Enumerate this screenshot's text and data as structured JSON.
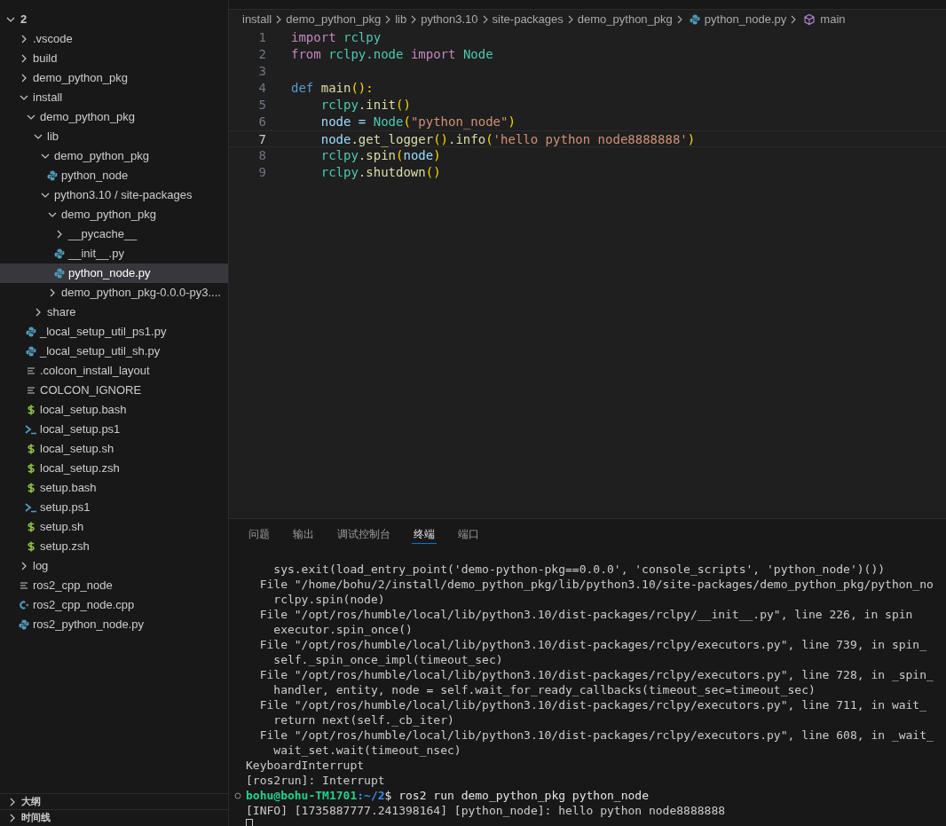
{
  "explorer": {
    "tree": {
      "label": "2",
      "kind": "folder",
      "expanded": true,
      "children": [
        {
          "label": ".vscode",
          "kind": "folder",
          "expanded": false
        },
        {
          "label": "build",
          "kind": "folder",
          "expanded": false
        },
        {
          "label": "demo_python_pkg",
          "kind": "folder",
          "expanded": false
        },
        {
          "label": "install",
          "kind": "folder",
          "expanded": true,
          "children": [
            {
              "label": "demo_python_pkg",
              "kind": "folder",
              "expanded": true,
              "children": [
                {
                  "label": "lib",
                  "kind": "folder",
                  "expanded": true,
                  "children": [
                    {
                      "label": "demo_python_pkg",
                      "kind": "folder",
                      "expanded": true,
                      "children": [
                        {
                          "label": "python_node",
                          "kind": "python",
                          "selected": false
                        }
                      ]
                    },
                    {
                      "label": "python3.10 / site-packages",
                      "kind": "folder",
                      "expanded": true,
                      "children": [
                        {
                          "label": "demo_python_pkg",
                          "kind": "folder",
                          "expanded": true,
                          "children": [
                            {
                              "label": "__pycache__",
                              "kind": "folder",
                              "expanded": false
                            },
                            {
                              "label": "__init__.py",
                              "kind": "python",
                              "selected": false
                            },
                            {
                              "label": "python_node.py",
                              "kind": "python",
                              "selected": true
                            }
                          ]
                        },
                        {
                          "label": "demo_python_pkg-0.0.0-py3....",
                          "kind": "folder",
                          "expanded": false
                        }
                      ]
                    }
                  ]
                },
                {
                  "label": "share",
                  "kind": "folder",
                  "expanded": false
                }
              ]
            },
            {
              "label": "_local_setup_util_ps1.py",
              "kind": "python",
              "selected": false
            },
            {
              "label": "_local_setup_util_sh.py",
              "kind": "python",
              "selected": false
            },
            {
              "label": ".colcon_install_layout",
              "kind": "text",
              "selected": false
            },
            {
              "label": "COLCON_IGNORE",
              "kind": "text",
              "selected": false
            },
            {
              "label": "local_setup.bash",
              "kind": "shell",
              "selected": false
            },
            {
              "label": "local_setup.ps1",
              "kind": "powershell",
              "selected": false
            },
            {
              "label": "local_setup.sh",
              "kind": "shell",
              "selected": false
            },
            {
              "label": "local_setup.zsh",
              "kind": "shell",
              "selected": false
            },
            {
              "label": "setup.bash",
              "kind": "shell",
              "selected": false
            },
            {
              "label": "setup.ps1",
              "kind": "powershell",
              "selected": false
            },
            {
              "label": "setup.sh",
              "kind": "shell",
              "selected": false
            },
            {
              "label": "setup.zsh",
              "kind": "shell",
              "selected": false
            }
          ]
        },
        {
          "label": "log",
          "kind": "folder",
          "expanded": false
        },
        {
          "label": "ros2_cpp_node",
          "kind": "text",
          "selected": false
        },
        {
          "label": "ros2_cpp_node.cpp",
          "kind": "cpp",
          "selected": false
        },
        {
          "label": "ros2_python_node.py",
          "kind": "python",
          "selected": false
        }
      ]
    },
    "sections": [
      {
        "label": "大纲",
        "expanded": false
      },
      {
        "label": "时间线",
        "expanded": false
      }
    ]
  },
  "breadcrumbs": [
    {
      "label": "install",
      "kind": "folder"
    },
    {
      "label": "demo_python_pkg",
      "kind": "folder"
    },
    {
      "label": "lib",
      "kind": "folder"
    },
    {
      "label": "python3.10",
      "kind": "folder"
    },
    {
      "label": "site-packages",
      "kind": "folder"
    },
    {
      "label": "demo_python_pkg",
      "kind": "folder"
    },
    {
      "label": "python_node.py",
      "kind": "python"
    },
    {
      "label": "main",
      "kind": "method"
    }
  ],
  "editor": {
    "lines": [
      {
        "number": "1",
        "current": false,
        "tokens": [
          {
            "text": "import ",
            "color": "#c586c0"
          },
          {
            "text": "rclpy",
            "color": "#4ec9b0"
          }
        ]
      },
      {
        "number": "2",
        "current": false,
        "tokens": [
          {
            "text": "from ",
            "color": "#c586c0"
          },
          {
            "text": "rclpy.node ",
            "color": "#4ec9b0"
          },
          {
            "text": "import ",
            "color": "#c586c0"
          },
          {
            "text": "Node",
            "color": "#4ec9b0"
          }
        ]
      },
      {
        "number": "3",
        "current": false
      },
      {
        "number": "4",
        "current": false,
        "tokens": [
          {
            "text": "def ",
            "color": "#569cd6"
          },
          {
            "text": "main",
            "color": "#dcdcaa"
          },
          {
            "text": "():",
            "color": "#ffd700"
          }
        ]
      },
      {
        "number": "5",
        "current": false,
        "tokens": [
          {
            "text": "    rclpy",
            "color": "#4ec9b0"
          },
          {
            "text": ".init",
            "color": "#dcdcaa"
          },
          {
            "text": "()",
            "color": "#ffd700"
          }
        ]
      },
      {
        "number": "6",
        "current": false,
        "tokens": [
          {
            "text": "    node =",
            "color": "#9cdcfe"
          },
          {
            "text": " Node",
            "color": "#4ec9b0"
          },
          {
            "text": "(",
            "color": "#ffd700"
          },
          {
            "text": "\"python_node\"",
            "color": "#ce9178"
          },
          {
            "text": ")",
            "color": "#ffd700"
          }
        ]
      },
      {
        "number": "7",
        "current": true,
        "tokens": [
          {
            "text": "    node",
            "color": "#9cdcfe"
          },
          {
            "text": ".get_logger",
            "color": "#dcdcaa"
          },
          {
            "text": "()",
            "color": "#ffd700"
          },
          {
            "text": ".info",
            "color": "#dcdcaa"
          },
          {
            "text": "(",
            "color": "#ffd700"
          },
          {
            "text": "'hello python node8888888'",
            "color": "#ce9178"
          },
          {
            "text": ")",
            "color": "#ffd700"
          }
        ]
      },
      {
        "number": "8",
        "current": false,
        "tokens": [
          {
            "text": "    rclpy",
            "color": "#4ec9b0"
          },
          {
            "text": ".spin",
            "color": "#dcdcaa"
          },
          {
            "text": "(",
            "color": "#ffd700"
          },
          {
            "text": "node",
            "color": "#9cdcfe"
          },
          {
            "text": ")",
            "color": "#ffd700"
          }
        ]
      },
      {
        "number": "9",
        "current": false,
        "tokens": [
          {
            "text": "    rclpy",
            "color": "#4ec9b0"
          },
          {
            "text": ".shutdown",
            "color": "#dcdcaa"
          },
          {
            "text": "()",
            "color": "#ffd700"
          }
        ]
      }
    ]
  },
  "panel": {
    "tabs": [
      {
        "label": "问题",
        "selected": false
      },
      {
        "label": "输出",
        "selected": false
      },
      {
        "label": "调试控制台",
        "selected": false
      },
      {
        "label": "终端",
        "selected": true
      },
      {
        "label": "端口",
        "selected": false
      }
    ],
    "terminal": [
      {
        "kind": "output",
        "text": "    sys.exit(load_entry_point('demo-python-pkg==0.0.0', 'console_scripts', 'python_node')())"
      },
      {
        "kind": "output",
        "text": "  File \"/home/bohu/2/install/demo_python_pkg/lib/python3.10/site-packages/demo_python_pkg/python_no"
      },
      {
        "kind": "output",
        "text": "    rclpy.spin(node)"
      },
      {
        "kind": "output",
        "text": "  File \"/opt/ros/humble/local/lib/python3.10/dist-packages/rclpy/__init__.py\", line 226, in spin"
      },
      {
        "kind": "output",
        "text": "    executor.spin_once()"
      },
      {
        "kind": "output",
        "text": "  File \"/opt/ros/humble/local/lib/python3.10/dist-packages/rclpy/executors.py\", line 739, in spin_"
      },
      {
        "kind": "output",
        "text": "    self._spin_once_impl(timeout_sec)"
      },
      {
        "kind": "output",
        "text": "  File \"/opt/ros/humble/local/lib/python3.10/dist-packages/rclpy/executors.py\", line 728, in _spin_"
      },
      {
        "kind": "output",
        "text": "    handler, entity, node = self.wait_for_ready_callbacks(timeout_sec=timeout_sec)"
      },
      {
        "kind": "output",
        "text": "  File \"/opt/ros/humble/local/lib/python3.10/dist-packages/rclpy/executors.py\", line 711, in wait_"
      },
      {
        "kind": "output",
        "text": "    return next(self._cb_iter)"
      },
      {
        "kind": "output",
        "text": "  File \"/opt/ros/humble/local/lib/python3.10/dist-packages/rclpy/executors.py\", line 608, in _wait_"
      },
      {
        "kind": "output",
        "text": "    wait_set.wait(timeout_nsec)"
      },
      {
        "kind": "output",
        "text": "KeyboardInterrupt"
      },
      {
        "kind": "output",
        "text": "[ros2run]: Interrupt"
      },
      {
        "kind": "prompt",
        "user_host": "bohu@bohu-TM1701",
        "path": ":~/2",
        "command": "$ ros2 run demo_python_pkg python_node"
      },
      {
        "kind": "output",
        "text": "[INFO] [1735887777.241398164] [python_node]: hello python node8888888"
      },
      {
        "kind": "cursor"
      }
    ]
  }
}
